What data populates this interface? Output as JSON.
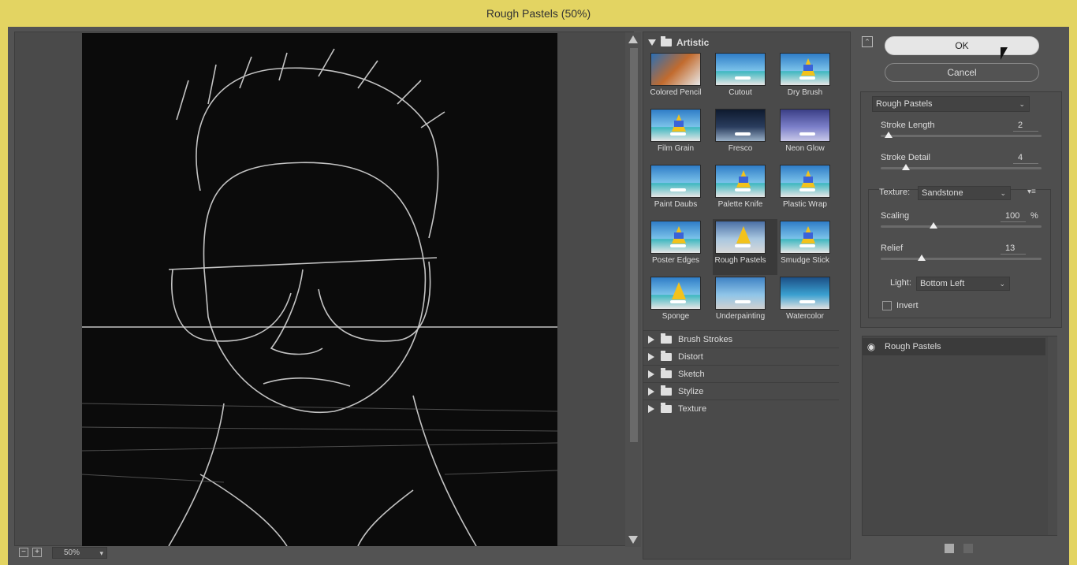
{
  "window": {
    "title": "Rough Pastels (50%)"
  },
  "zoom": {
    "value": "50%",
    "minus": "−",
    "plus": "+"
  },
  "gallery": {
    "open_category": "Artistic",
    "thumbnails": [
      {
        "label": "Colored Pencil"
      },
      {
        "label": "Cutout"
      },
      {
        "label": "Dry Brush"
      },
      {
        "label": "Film Grain"
      },
      {
        "label": "Fresco"
      },
      {
        "label": "Neon Glow"
      },
      {
        "label": "Paint Daubs"
      },
      {
        "label": "Palette Knife"
      },
      {
        "label": "Plastic Wrap"
      },
      {
        "label": "Poster Edges"
      },
      {
        "label": "Rough Pastels"
      },
      {
        "label": "Smudge Stick"
      },
      {
        "label": "Sponge"
      },
      {
        "label": "Underpainting"
      },
      {
        "label": "Watercolor"
      }
    ],
    "selected": "Rough Pastels",
    "categories": [
      {
        "label": "Brush Strokes"
      },
      {
        "label": "Distort"
      },
      {
        "label": "Sketch"
      },
      {
        "label": "Stylize"
      },
      {
        "label": "Texture"
      }
    ]
  },
  "buttons": {
    "ok": "OK",
    "cancel": "Cancel"
  },
  "filter_select": "Rough Pastels",
  "params": {
    "stroke_length": {
      "label": "Stroke Length",
      "value": "2"
    },
    "stroke_detail": {
      "label": "Stroke Detail",
      "value": "4"
    },
    "texture": {
      "label": "Texture:",
      "value": "Sandstone"
    },
    "scaling": {
      "label": "Scaling",
      "value": "100",
      "unit": "%"
    },
    "relief": {
      "label": "Relief",
      "value": "13"
    },
    "light": {
      "label": "Light:",
      "value": "Bottom Left"
    },
    "invert": {
      "label": "Invert"
    }
  },
  "layers": [
    {
      "name": "Rough Pastels"
    }
  ]
}
